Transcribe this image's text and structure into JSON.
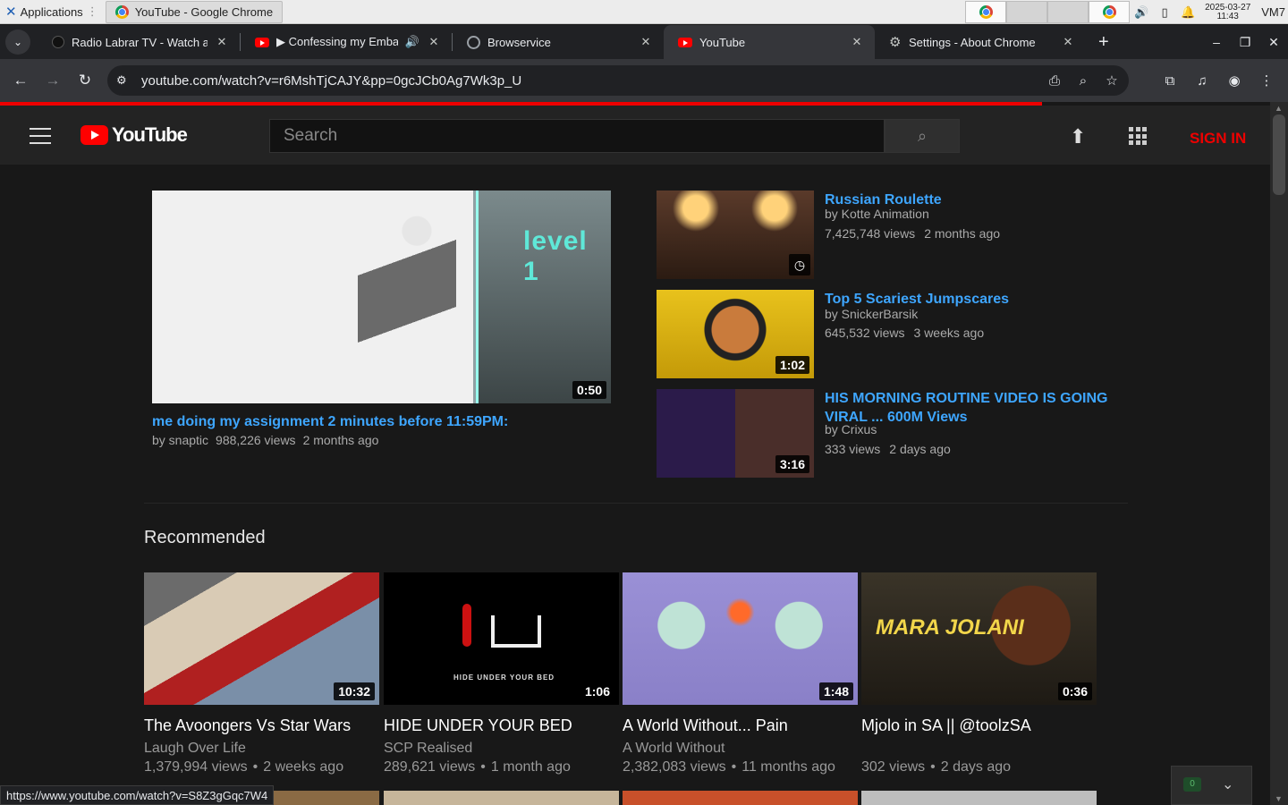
{
  "taskbar": {
    "apps_label": "Applications",
    "task_label": "YouTube - Google Chrome",
    "clock_date": "2025-03-27",
    "clock_time": "11:43",
    "vm_label": "VM7"
  },
  "tabs": [
    {
      "title": "Radio Labrar TV - Watch at",
      "icon": "dark-favicon"
    },
    {
      "title": "▶ Confessing my Embar",
      "icon": "youtube-favicon",
      "audio": true
    },
    {
      "title": "Browservice",
      "icon": "globe-icon"
    },
    {
      "title": "YouTube",
      "icon": "youtube-favicon",
      "active": true
    },
    {
      "title": "Settings - About Chrome",
      "icon": "gear-icon"
    }
  ],
  "omnibox": {
    "url": "youtube.com/watch?v=r6MshTjCAJY&pp=0gcJCb0Ag7Wk3p_U"
  },
  "youtube": {
    "logo_text": "YouTube",
    "search_placeholder": "Search",
    "sign_in": "SIGN IN",
    "accent_color": "#ff0000",
    "link_color": "#3ea6ff"
  },
  "featured": {
    "title": "me doing my assignment 2 minutes before 11:59PM:",
    "channel": "by snaptic",
    "views": "988,226 views",
    "age": "2 months ago",
    "duration": "0:50",
    "thumb_text": "level 1"
  },
  "related": [
    {
      "title": "Russian Roulette",
      "channel": "by Kotte Animation",
      "views": "7,425,748 views",
      "age": "2 months ago",
      "overlay": "clock-icon"
    },
    {
      "title": "Top 5 Scariest Jumpscares",
      "channel": "by SnickerBarsik",
      "views": "645,532 views",
      "age": "3 weeks ago",
      "duration": "1:02"
    },
    {
      "title": "HIS MORNING ROUTINE VIDEO IS GOING VIRAL ... 600M Views",
      "channel": "by Crixus",
      "views": "333 views",
      "age": "2 days ago",
      "duration": "3:16"
    }
  ],
  "recommended_heading": "Recommended",
  "recommended": [
    {
      "title": "The Avoongers Vs Star Wars",
      "channel": "Laugh Over Life",
      "views": "1,379,994 views",
      "age": "2 weeks ago",
      "duration": "10:32"
    },
    {
      "title": "HIDE UNDER YOUR BED",
      "channel": "SCP Realised",
      "views": "289,621 views",
      "age": "1 month ago",
      "duration": "1:06",
      "thumb_text": "HIDE UNDER YOUR BED"
    },
    {
      "title": "A World Without... Pain",
      "channel": "A World Without",
      "views": "2,382,083 views",
      "age": "11 months ago",
      "duration": "1:48"
    },
    {
      "title": "Mjolo in SA || @toolzSA",
      "channel": "",
      "views": "302 views",
      "age": "2 days ago",
      "duration": "0:36",
      "thumb_text": "MARA JOLANI"
    }
  ],
  "status_url": "https://www.youtube.com/watch?v=S8Z3gGqc7W4",
  "widget_badge": "0"
}
